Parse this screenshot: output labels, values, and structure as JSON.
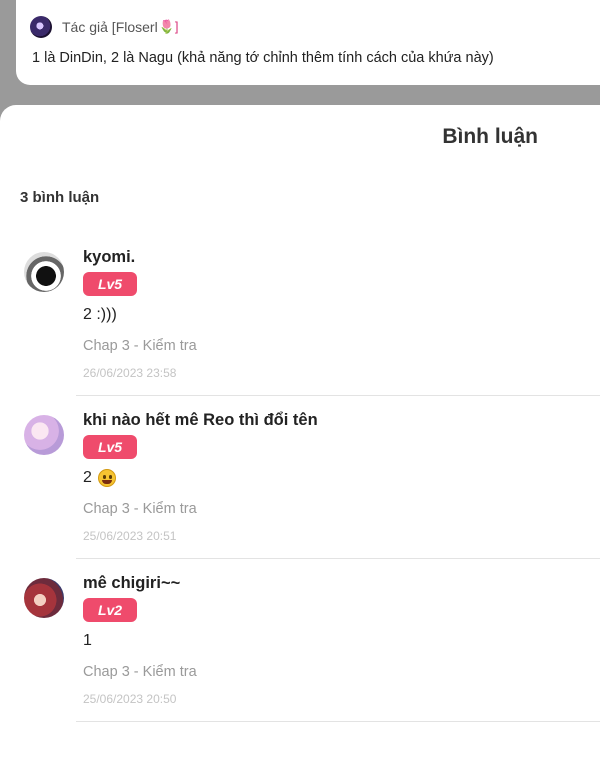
{
  "author": {
    "name": "Tác giả [Floserl",
    "flower": "🌷]",
    "note": "1 là DinDin, 2 là Nagu (khả năng tớ chỉnh thêm tính cách của khứa này)"
  },
  "panel": {
    "title": "Bình luận",
    "count_label": "3 bình luận"
  },
  "comments": [
    {
      "name": "kyomi.",
      "level": "Lv5",
      "content": "2 :)))",
      "chapter": "Chap 3 - Kiểm tra",
      "time": "26/06/2023 23:58"
    },
    {
      "name": "khi nào hết mê Reo thì đổi tên",
      "level": "Lv5",
      "content": "2",
      "emoji": "grinning-face-emoji",
      "chapter": "Chap 3 - Kiểm tra",
      "time": "25/06/2023 20:51"
    },
    {
      "name": "mê chigiri~~",
      "level": "Lv2",
      "content": "1",
      "chapter": "Chap 3 - Kiểm tra",
      "time": "25/06/2023 20:50"
    }
  ],
  "colors": {
    "level_badge": "#ef4b6c",
    "backdrop": "#9a9a9a"
  }
}
